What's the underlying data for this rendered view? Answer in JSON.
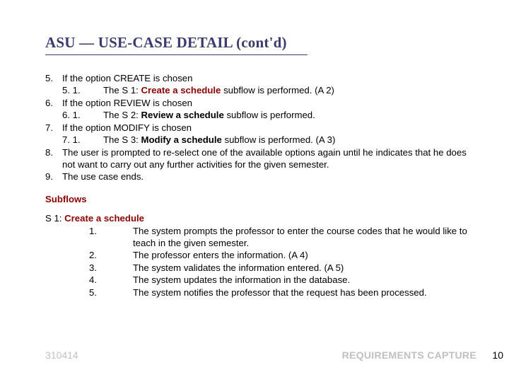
{
  "title": "ASU — USE-CASE DETAIL (cont'd)",
  "steps": [
    {
      "n": "5.",
      "text": "If the option CREATE is chosen",
      "sub_n": "5. 1.",
      "sub_prefix": "The S 1: ",
      "sub_maroon": "Create a schedule",
      "sub_suffix": " subflow is performed. (A 2)"
    },
    {
      "n": "6.",
      "text": "If the option REVIEW is chosen",
      "sub_n": "6. 1.",
      "sub_prefix": "The S 2: ",
      "sub_bold": "Review a schedule",
      "sub_suffix": " subflow is performed."
    },
    {
      "n": "7.",
      "text": "If the option MODIFY is chosen",
      "sub_n": "7. 1.",
      "sub_prefix": "The S 3: ",
      "sub_bold": "Modify a schedule",
      "sub_suffix": " subflow is performed. (A 3)"
    },
    {
      "n": "8.",
      "text": "The user is prompted to re-select one of the available options again until he indicates that he does not want to carry out any further activities for the given semester."
    },
    {
      "n": "9.",
      "text": "The use case ends."
    }
  ],
  "subflows_header": "Subflows",
  "s1_label_prefix": "S 1: ",
  "s1_label_maroon": "Create a schedule",
  "s1_items": [
    {
      "n": "1.",
      "text": "The system prompts the professor to enter the course codes that he would like to teach in the given semester."
    },
    {
      "n": "2.",
      "text": "The professor enters the information. (A 4)"
    },
    {
      "n": "3.",
      "text": "The system validates the information entered. (A 5)"
    },
    {
      "n": "4.",
      "text": "The system updates the information in the database."
    },
    {
      "n": "5.",
      "text": "The system notifies the professor that the request has been processed."
    }
  ],
  "footer_left": "310414",
  "footer_right": "REQUIREMENTS CAPTURE",
  "page_num": "10"
}
